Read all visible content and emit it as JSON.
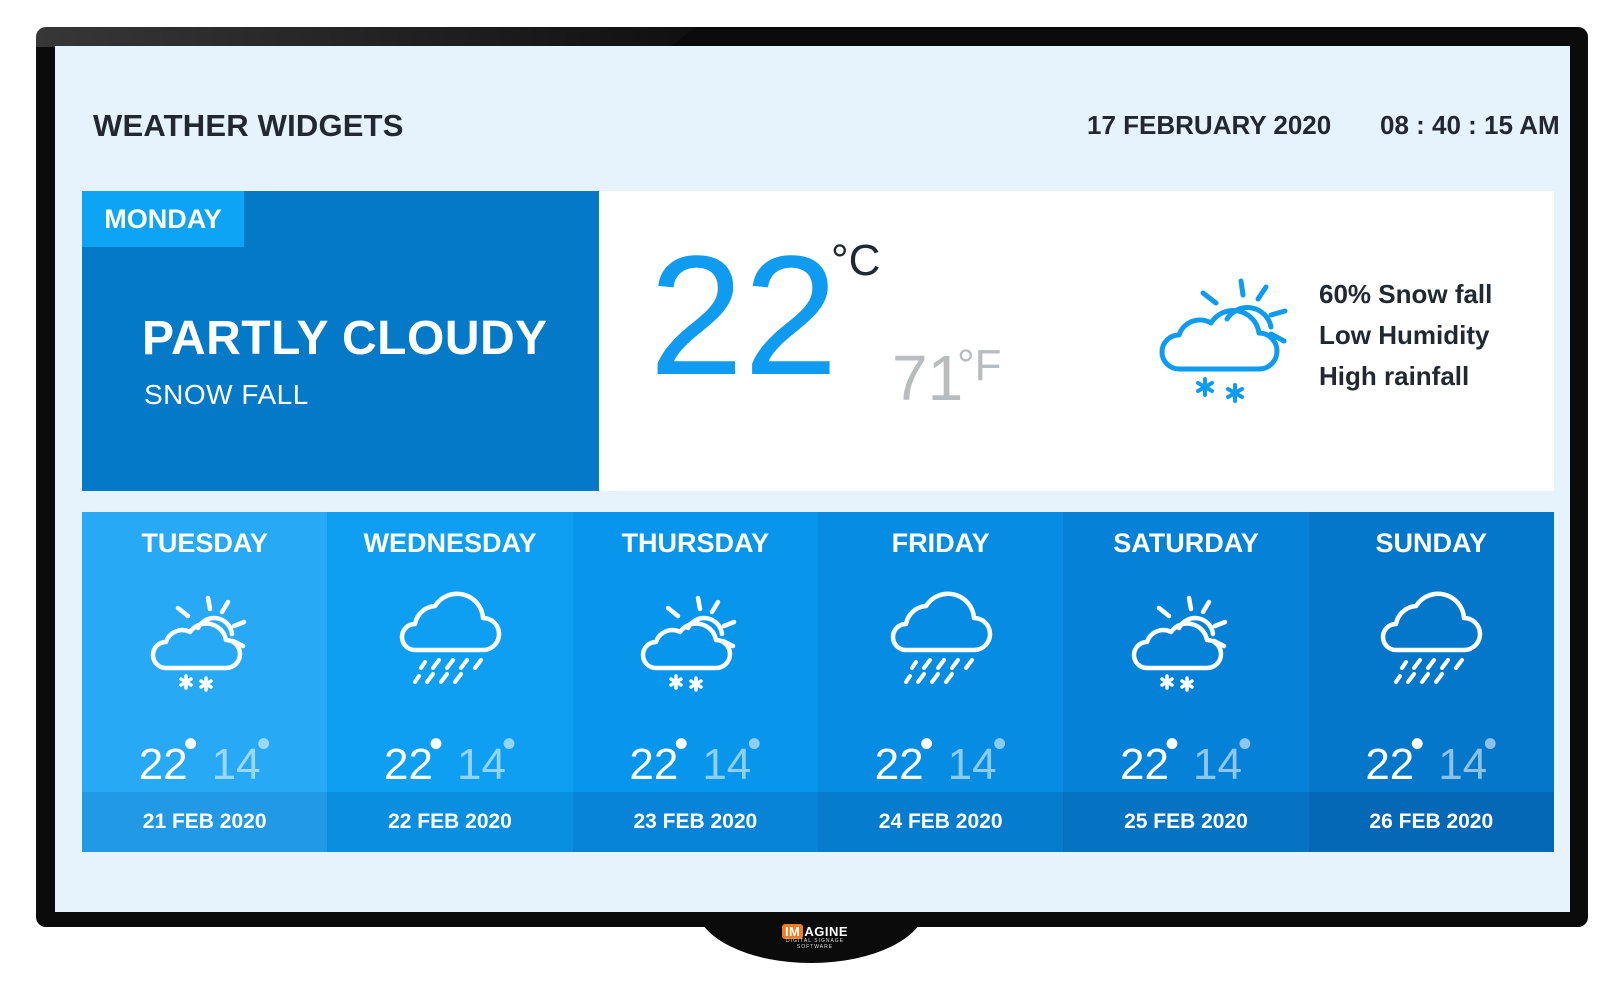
{
  "header": {
    "title": "WEATHER WIDGETS",
    "date": "17 FEBRUARY 2020",
    "time": "08 : 40 : 15 AM"
  },
  "today": {
    "day": "MONDAY",
    "condition": "PARTLY CLOUDY",
    "sub_condition": "SNOW FALL",
    "temp_c": "22",
    "unit_c": "°C",
    "temp_f": "71",
    "unit_f": "°F",
    "icon": "partly-cloudy-snow-icon",
    "details": [
      "60% Snow fall",
      "Low Humidity",
      "High rainfall"
    ]
  },
  "forecast": [
    {
      "day": "TUESDAY",
      "icon": "partly-cloudy-snow-icon",
      "high": "22",
      "low": "14",
      "date": "21 FEB 2020",
      "bg": "#27a9f6",
      "date_bg": "#2199e4"
    },
    {
      "day": "WEDNESDAY",
      "icon": "rain-cloud-icon",
      "high": "22",
      "low": "14",
      "date": "22 FEB 2020",
      "bg": "#0e9ff3",
      "date_bg": "#0a8ee0"
    },
    {
      "day": "THURSDAY",
      "icon": "partly-cloudy-snow-icon",
      "high": "22",
      "low": "14",
      "date": "23 FEB 2020",
      "bg": "#0895ec",
      "date_bg": "#0784d8"
    },
    {
      "day": "FRIDAY",
      "icon": "rain-cloud-icon",
      "high": "22",
      "low": "14",
      "date": "24 FEB 2020",
      "bg": "#068ce3",
      "date_bg": "#057cce"
    },
    {
      "day": "SATURDAY",
      "icon": "partly-cloudy-snow-icon",
      "high": "22",
      "low": "14",
      "date": "25 FEB 2020",
      "bg": "#0681d8",
      "date_bg": "#0572c2"
    },
    {
      "day": "SUNDAY",
      "icon": "rain-cloud-icon",
      "high": "22",
      "low": "14",
      "date": "26 FEB 2020",
      "bg": "#0577cb",
      "date_bg": "#0468b7"
    }
  ],
  "branding": {
    "logo_prefix": "IM",
    "logo_text": "AGINE",
    "logo_sub": "DIGITAL SIGNAGE SOFTWARE"
  }
}
